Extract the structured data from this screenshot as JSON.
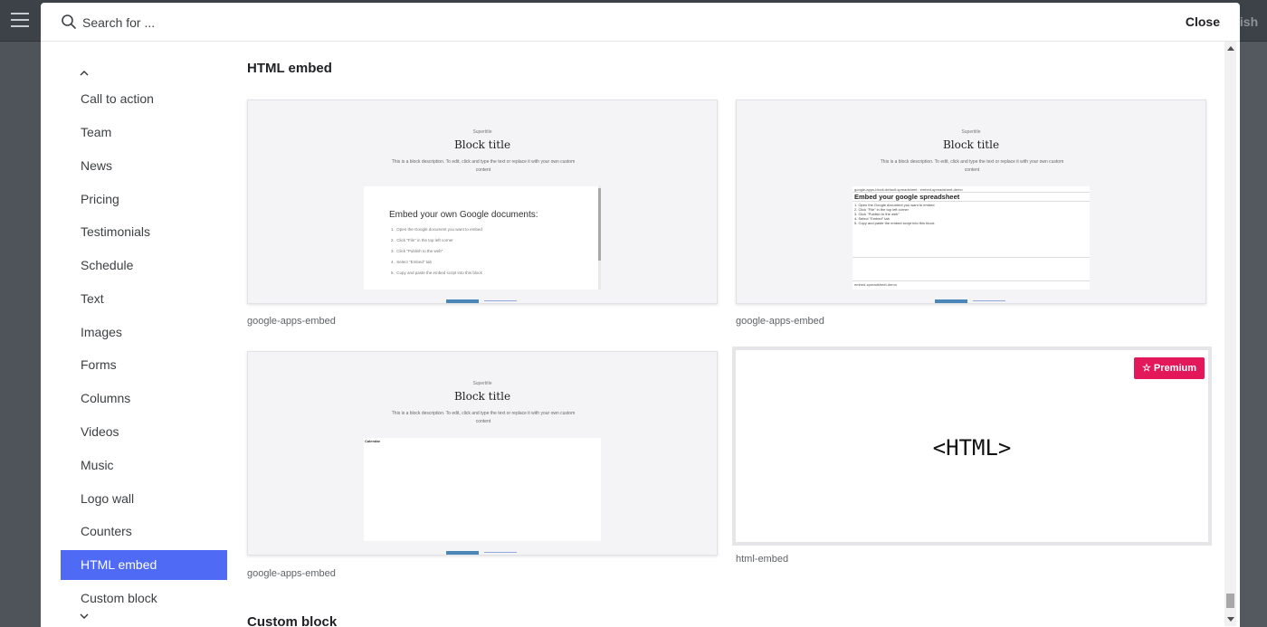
{
  "header": {
    "search_placeholder": "Search for ...",
    "close_label": "Close"
  },
  "background": {
    "publish_label": "lish"
  },
  "sidebar": {
    "items": [
      {
        "label": "Call to action"
      },
      {
        "label": "Team"
      },
      {
        "label": "News"
      },
      {
        "label": "Pricing"
      },
      {
        "label": "Testimonials"
      },
      {
        "label": "Schedule"
      },
      {
        "label": "Text"
      },
      {
        "label": "Images"
      },
      {
        "label": "Forms"
      },
      {
        "label": "Columns"
      },
      {
        "label": "Videos"
      },
      {
        "label": "Music"
      },
      {
        "label": "Logo wall"
      },
      {
        "label": "Counters"
      },
      {
        "label": "HTML embed",
        "active": true
      },
      {
        "label": "Custom block"
      }
    ]
  },
  "main": {
    "section_title": "HTML embed",
    "next_section_title": "Custom block",
    "cards": [
      {
        "caption": "google-apps-embed",
        "preview": {
          "supertitle": "Supertitle",
          "title": "Block title",
          "description": "This is a block description. To edit, click and type the text or replace it with your own custom content",
          "doc_heading": "Embed your own Google documents:",
          "doc_steps": [
            "Open the Google document you want to embed",
            "Click \"File\" in the top left corner",
            "Click \"Publish to the web\"",
            "Select \"Embed\" tab",
            "Copy and paste the embed script into this block"
          ]
        }
      },
      {
        "caption": "google-apps-embed",
        "preview": {
          "supertitle": "Supertitle",
          "title": "Block title",
          "description": "This is a block description. To edit, click and type the text or replace it with your own custom content",
          "sheet_top": "google-apps-block-default-spreadsheet : embed-spreadsheet-demo",
          "sheet_heading": "Embed your google spreadsheet",
          "sheet_steps": [
            "1. Open the Google document you want to embed",
            "2. Click \"File\" in the top left corner",
            "3. Click \"Publish to the web\"",
            "4. Select \"Embed\" tab",
            "5. Copy and paste the embed script into this block"
          ],
          "sheet_footer": "embed-spreadsheet-demo"
        }
      },
      {
        "caption": "google-apps-embed",
        "preview": {
          "supertitle": "Supertitle",
          "title": "Block title",
          "description": "This is a block description. To edit, click and type the text or replace it with your own custom content",
          "calendar_label": "Calendar"
        }
      },
      {
        "caption": "html-embed",
        "preview": {
          "code_label": "<HTML>",
          "badge": "Premium"
        }
      }
    ]
  },
  "colors": {
    "accent": "#4f6bf5",
    "premium": "#e2185b"
  }
}
